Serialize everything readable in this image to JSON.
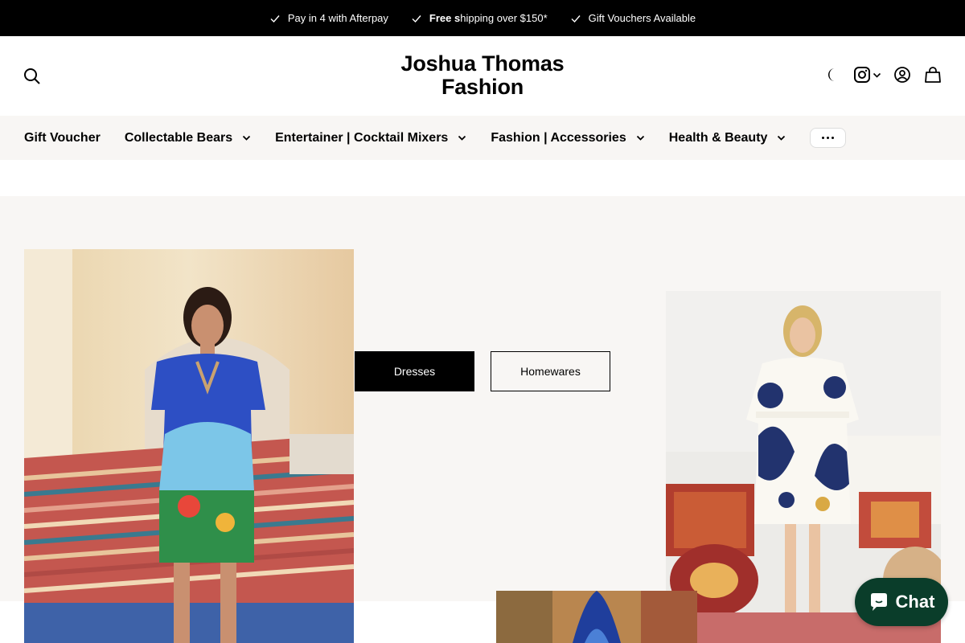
{
  "announcement": {
    "items": [
      {
        "text": "Pay in 4 with Afterpay"
      },
      {
        "bold": "Free s",
        "text": "hipping over $150*"
      },
      {
        "text": "Gift Vouchers Available"
      }
    ]
  },
  "header": {
    "logo_line1": "Joshua Thomas",
    "logo_line2": "Fashion",
    "icons": [
      "search-icon",
      "moon-icon",
      "instagram-icon",
      "chevron-down-icon",
      "account-icon",
      "bag-icon"
    ]
  },
  "nav": {
    "items": [
      {
        "label": "Gift Voucher",
        "dropdown": false
      },
      {
        "label": "Collectable Bears",
        "dropdown": true
      },
      {
        "label": "Entertainer | Cocktail Mixers",
        "dropdown": true
      },
      {
        "label": "Fashion | Accessories",
        "dropdown": true
      },
      {
        "label": "Health & Beauty",
        "dropdown": true
      }
    ]
  },
  "hero": {
    "buttons": [
      {
        "label": "Dresses"
      },
      {
        "label": "Homewares"
      }
    ]
  },
  "chat": {
    "label": "Chat"
  },
  "colors": {
    "announcement_bg": "#000000",
    "nav_bg": "#f8f6f4",
    "chat_bg": "#0a3d2a"
  }
}
